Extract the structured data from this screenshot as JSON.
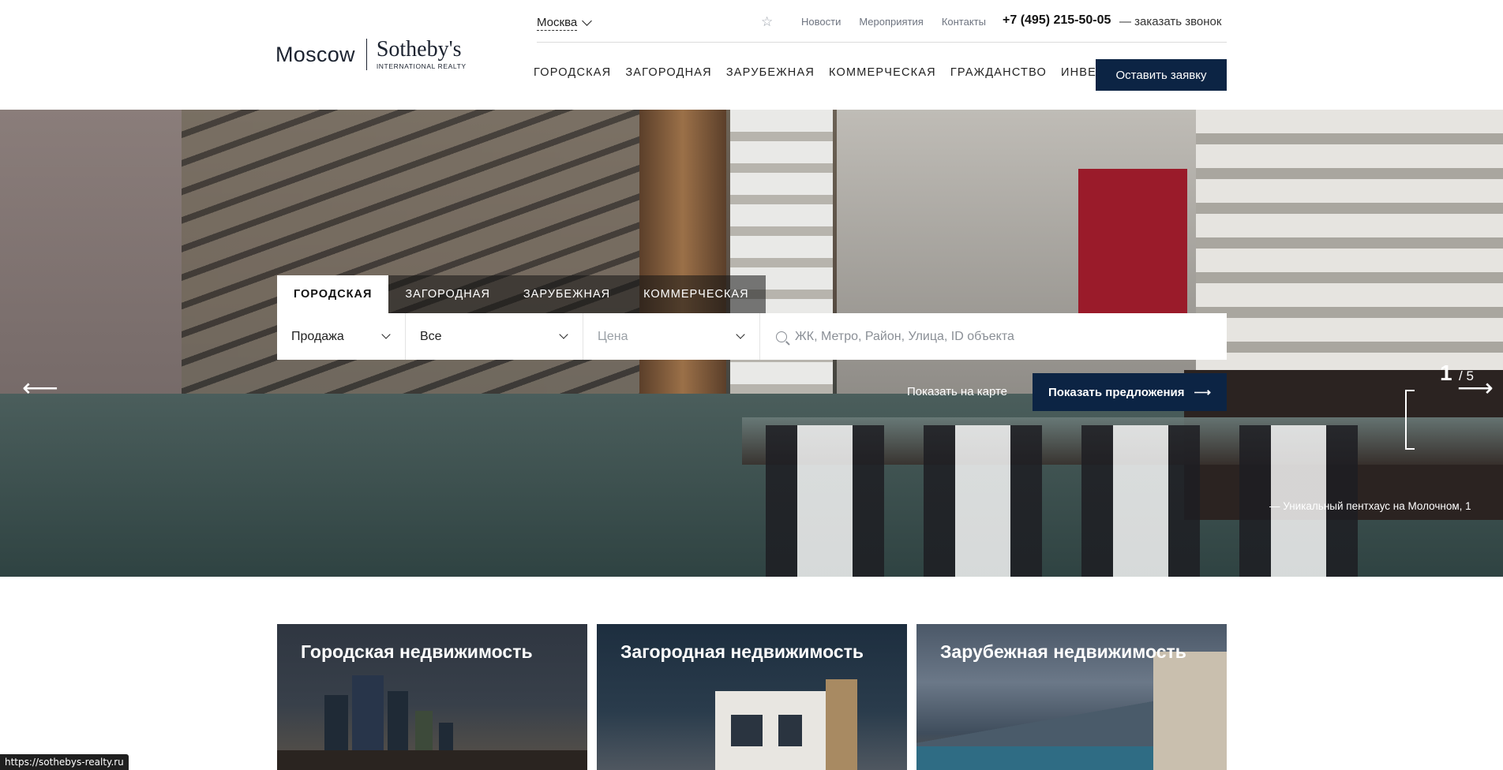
{
  "logo": {
    "city": "Moscow",
    "brand": "Sotheby's",
    "sub": "INTERNATIONAL REALTY"
  },
  "topbar": {
    "city": "Москва",
    "links": [
      "Новости",
      "Мероприятия",
      "Контакты"
    ],
    "phone": "+7 (495) 215-50-05",
    "callback": "— заказать звонок"
  },
  "nav": {
    "items": [
      "ГОРОДСКАЯ",
      "ЗАГОРОДНАЯ",
      "ЗАРУБЕЖНАЯ",
      "КОММЕРЧЕСКАЯ",
      "ГРАЖДАНСТВО",
      "ИНВЕСТИЦИИ"
    ],
    "apply_label": "Оставить заявку"
  },
  "search": {
    "tabs": [
      "ГОРОДСКАЯ",
      "ЗАГОРОДНАЯ",
      "ЗАРУБЕЖНАЯ",
      "КОММЕРЧЕСКАЯ"
    ],
    "active_tab": 0,
    "deal_value": "Продажа",
    "type_value": "Все",
    "price_placeholder": "Цена",
    "query_placeholder": "ЖК, Метро, Район, Улица, ID объекта",
    "map_link": "Показать на карте",
    "offers_label": "Показать предложения"
  },
  "slider": {
    "current": "1",
    "total": "/ 5",
    "caption": "— Уникальный пентхаус на Молочном, 1"
  },
  "cards": [
    {
      "title": "Городская недвижимость"
    },
    {
      "title": "Загородная недвижимость"
    },
    {
      "title": "Зарубежная недвижимость"
    }
  ],
  "status_url": "https://sothebys-realty.ru",
  "colors": {
    "accent": "#0c2444"
  }
}
